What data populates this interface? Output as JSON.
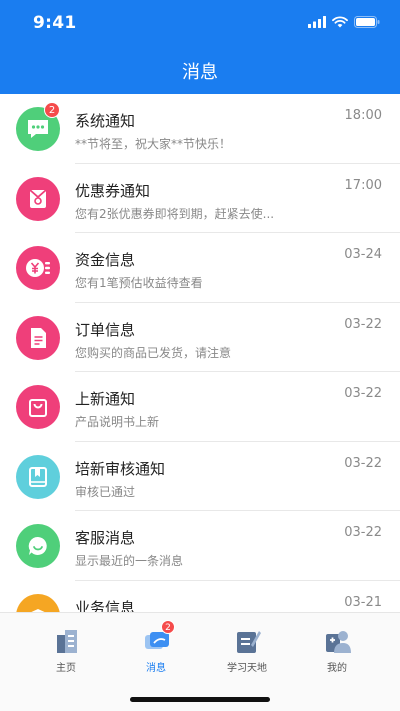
{
  "status_bar": {
    "time": "9:41"
  },
  "header": {
    "title": "消息"
  },
  "messages": [
    {
      "title": "系统通知",
      "subtitle": "**节将至，祝大家**节快乐！",
      "time": "18:00",
      "icon": "chat-bubble-icon",
      "color": "#4fcf7a",
      "badge": "2"
    },
    {
      "title": "优惠券通知",
      "subtitle": "您有2张优惠券即将到期，赶紧去使...",
      "time": "17:00",
      "icon": "coupon-icon",
      "color": "#ef3f7a"
    },
    {
      "title": "资金信息",
      "subtitle": "您有1笔预估收益待查看",
      "time": "03-24",
      "icon": "yuan-coin-icon",
      "color": "#ef3f7a"
    },
    {
      "title": "订单信息",
      "subtitle": "您购买的商品已发货，请注意",
      "time": "03-22",
      "icon": "document-icon",
      "color": "#ef3f7a"
    },
    {
      "title": "上新通知",
      "subtitle": "产品说明书上新",
      "time": "03-22",
      "icon": "shopping-bag-icon",
      "color": "#ef3f7a"
    },
    {
      "title": "培新审核通知",
      "subtitle": "审核已通过",
      "time": "03-22",
      "icon": "book-icon",
      "color": "#5fcfdc"
    },
    {
      "title": "客服消息",
      "subtitle": "显示最近的一条消息",
      "time": "03-22",
      "icon": "customer-service-icon",
      "color": "#4fcf7a"
    },
    {
      "title": "业务信息",
      "subtitle": "",
      "time": "03-21",
      "icon": "graduation-cap-icon",
      "color": "#f5a623"
    }
  ],
  "tabs": [
    {
      "label": "主页",
      "icon": "home-building-icon"
    },
    {
      "label": "消息",
      "icon": "message-icon",
      "badge": "2"
    },
    {
      "label": "学习天地",
      "icon": "study-edit-icon"
    },
    {
      "label": "我的",
      "icon": "user-profile-icon"
    }
  ],
  "colors": {
    "primary": "#1a7df0",
    "badge": "#f54b4b"
  }
}
